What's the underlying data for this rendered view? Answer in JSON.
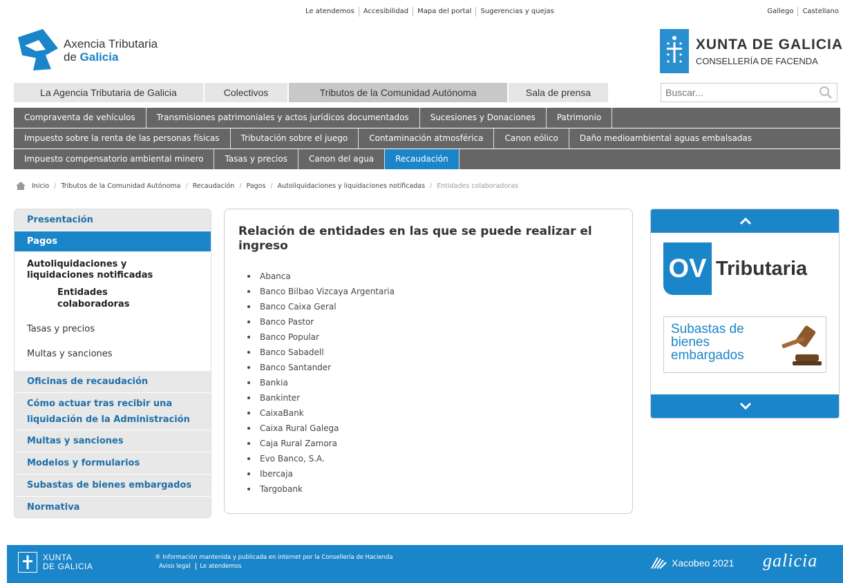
{
  "utility_links": [
    "Le atendemos",
    "Accesibilidad",
    "Mapa del portal",
    "Sugerencias y quejas"
  ],
  "languages": [
    "Gallego",
    "Castellano"
  ],
  "logo": {
    "line1": "Axencia Tributaria",
    "line2_prefix": "de ",
    "line2_highlight": "Galicia"
  },
  "xunta": {
    "title": "XUNTA DE GALICIA",
    "subtitle": "CONSELLERÍA DE FACENDA"
  },
  "main_nav": [
    {
      "label": "La Agencia Tributaria de Galicia",
      "active": false
    },
    {
      "label": "Colectivos",
      "active": false
    },
    {
      "label": "Tributos de la Comunidad Autónoma",
      "active": true
    },
    {
      "label": "Sala de prensa",
      "active": false
    }
  ],
  "search": {
    "placeholder": "Buscar..."
  },
  "sub_nav_1": [
    "Compraventa de vehículos",
    "Transmisiones patrimoniales y actos jurídicos documentados",
    "Sucesiones y Donaciones",
    "Patrimonio"
  ],
  "sub_nav_2": [
    "Impuesto sobre la renta de las personas físicas",
    "Tributación sobre el juego",
    "Contaminación atmosférica",
    "Canon eólico",
    "Daño medioambiental aguas embalsadas"
  ],
  "sub_nav_3": [
    {
      "label": "Impuesto compensatorio ambiental minero",
      "active": false
    },
    {
      "label": "Tasas y precios",
      "active": false
    },
    {
      "label": "Canon del agua",
      "active": false
    },
    {
      "label": "Recaudación",
      "active": true
    }
  ],
  "breadcrumb": [
    "Inicio",
    "Tributos de la Comunidad Autónoma",
    "Recaudación",
    "Pagos",
    "Autoliquidaciones y liquidaciones notificadas",
    "Entidades colaboradoras"
  ],
  "left_menu": {
    "presentacion": "Presentación",
    "pagos": "Pagos",
    "autoliquidaciones": "Autoliquidaciones y liquidaciones notificadas",
    "entidades": "Entidades colaboradoras",
    "tasas": "Tasas y precios",
    "multas_sub": "Multas y sanciones",
    "oficinas": "Oficinas de recaudación",
    "como_actuar": "Cómo actuar tras recibir una liquidación de la Administración",
    "multas": "Multas y sanciones",
    "modelos": "Modelos y formularios",
    "subastas": "Subastas de bienes embargados",
    "normativa": "Normativa"
  },
  "content": {
    "title": "Relación de entidades en las que se puede realizar el ingreso",
    "entities": [
      "Abanca",
      "Banco Bilbao Vizcaya Argentaria",
      "Banco Caixa Geral",
      "Banco Pastor",
      "Banco Popular",
      "Banco Sabadell",
      "Banco Santander",
      "Bankia",
      "Bankinter",
      "CaixaBank",
      "Caixa Rural Galega",
      "Caja Rural Zamora",
      "Evo Banco, S.A.",
      "Ibercaja",
      "Targobank"
    ]
  },
  "banner": {
    "ov_box": "OV",
    "ov_text": "Tributaria",
    "subastas": "Subastas de bienes embargados"
  },
  "footer": {
    "logo_line1": "XUNTA",
    "logo_line2": "DE GALICIA",
    "info": "® Información mantenida y publicada en internet por la Consellería de Hacienda",
    "links": [
      "Aviso legal",
      "Le atendemos"
    ],
    "xacobeo": "Xacobeo 2021",
    "galicia": "galicia"
  },
  "colors": {
    "primary_blue": "#1a85c8",
    "subnav_gray": "#666666",
    "menu_gray": "#e8e8e8"
  }
}
